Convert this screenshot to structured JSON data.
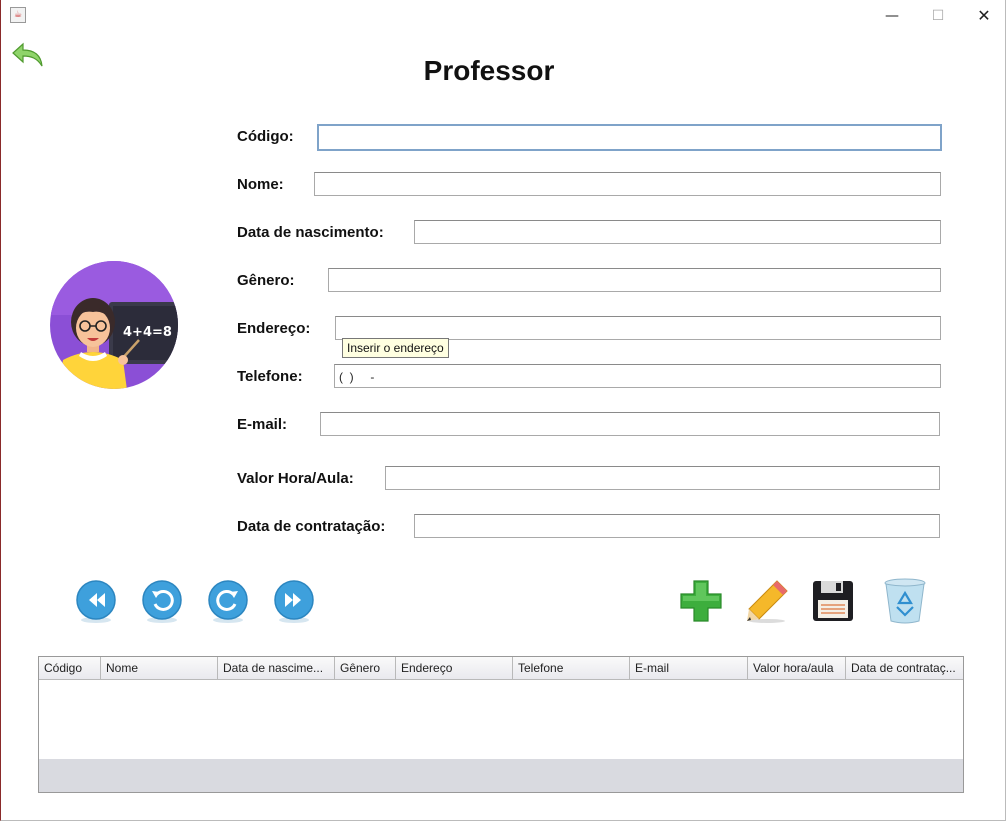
{
  "window": {
    "minimize": "—",
    "maximize": "☐",
    "close": "✕"
  },
  "page_title": "Professor",
  "form": {
    "codigo_label": "Código:",
    "nome_label": "Nome:",
    "nascimento_label": "Data de nascimento:",
    "genero_label": "Gênero:",
    "endereco_label": "Endereço:",
    "telefone_label": "Telefone:",
    "telefone_mask": "(  )     -",
    "email_label": "E-mail:",
    "valor_label": "Valor Hora/Aula:",
    "contratacao_label": "Data de contratação:",
    "endereco_tooltip": "Inserir o endereço"
  },
  "avatar": {
    "board_text": "4+4=8"
  },
  "table": {
    "columns": [
      "Código",
      "Nome",
      "Data de nascime...",
      "Gênero",
      "Endereço",
      "Telefone",
      "E-mail",
      "Valor hora/aula",
      "Data de contrataç..."
    ]
  },
  "colors": {
    "nav_button": "#3ea0dc",
    "add_green": "#3dae3d",
    "avatar_bg": "#8b4fd6"
  }
}
